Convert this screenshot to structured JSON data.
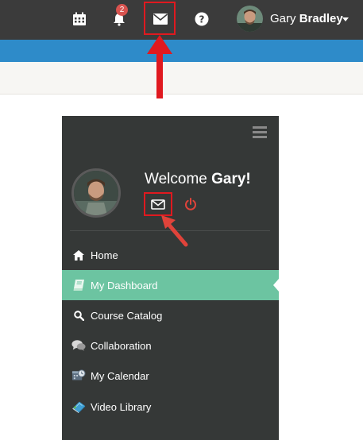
{
  "topbar": {
    "notification_count": "2",
    "user_first": "Gary",
    "user_last": "Bradley",
    "icons": [
      "calendar-icon",
      "bell-icon",
      "envelope-icon",
      "help-icon"
    ]
  },
  "sidebar": {
    "welcome_prefix": "Welcome",
    "welcome_name": "Gary!",
    "items": [
      {
        "label": "Home",
        "icon": "home-icon"
      },
      {
        "label": "My Dashboard",
        "icon": "book-icon",
        "active": true
      },
      {
        "label": "Course Catalog",
        "icon": "search-icon"
      },
      {
        "label": "Collaboration",
        "icon": "chat-icon"
      },
      {
        "label": "My Calendar",
        "icon": "calendar-clock-icon"
      },
      {
        "label": "Video Library",
        "icon": "video-book-icon"
      }
    ]
  },
  "colors": {
    "topbar": "#3b3b3b",
    "blue_strip": "#2e8bc9",
    "panel": "#353837",
    "active_item": "#6cc4a1",
    "highlight": "#e0191f",
    "power": "#e0433a"
  }
}
